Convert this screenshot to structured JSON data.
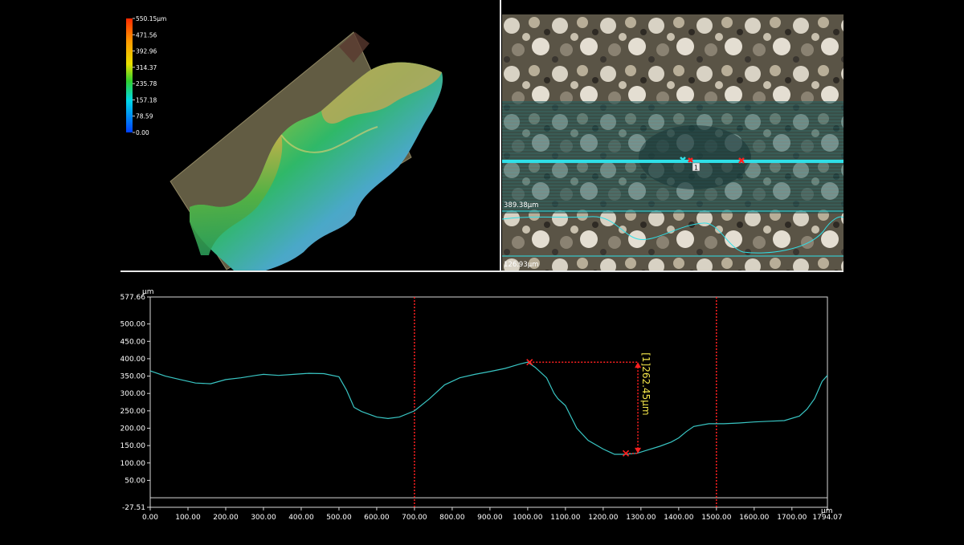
{
  "colorbar": {
    "ticks": [
      "550.15µm",
      "471.56",
      "392.96",
      "314.37",
      "235.78",
      "157.18",
      "78.59",
      "0.00"
    ]
  },
  "image_view": {
    "upper_line_label": "389.38µm",
    "lower_line_label": "126.93µm",
    "marker_label": "1",
    "colors": {
      "scan_line": "#2fe0e8",
      "marker": "#ff2020"
    }
  },
  "chart_data": {
    "type": "line",
    "xlabel": "µm",
    "ylabel": "µm",
    "xlim": [
      0.0,
      1794.07
    ],
    "ylim": [
      -27.51,
      577.66
    ],
    "x_ticks": [
      "0.00",
      "100.00",
      "200.00",
      "300.00",
      "400.00",
      "500.00",
      "600.00",
      "700.00",
      "800.00",
      "900.00",
      "1000.00",
      "1100.00",
      "1200.00",
      "1300.00",
      "1400.00",
      "1500.00",
      "1600.00",
      "1700.00",
      "1794.07"
    ],
    "y_ticks": [
      "577.66",
      "500.00",
      "450.00",
      "400.00",
      "350.00",
      "300.00",
      "250.00",
      "200.00",
      "150.00",
      "100.00",
      "50.00",
      "-27.51"
    ],
    "series": [
      {
        "x": [
          0,
          40,
          80,
          120,
          160,
          200,
          240,
          280,
          300,
          340,
          380,
          420,
          460,
          500,
          520,
          540,
          560,
          600,
          630,
          660,
          700,
          740,
          780,
          820,
          860,
          900,
          940,
          980,
          1000,
          1020,
          1050,
          1070,
          1080,
          1100,
          1130,
          1160,
          1200,
          1230,
          1260,
          1290,
          1320,
          1350,
          1380,
          1400,
          1420,
          1440,
          1480,
          1520,
          1560,
          1600,
          1640,
          1680,
          1720,
          1740,
          1760,
          1780,
          1794
        ],
        "y": [
          365,
          350,
          340,
          330,
          328,
          340,
          345,
          352,
          355,
          352,
          355,
          358,
          357,
          348,
          310,
          260,
          248,
          232,
          228,
          232,
          250,
          285,
          325,
          345,
          355,
          363,
          372,
          385,
          390,
          375,
          345,
          300,
          285,
          265,
          200,
          165,
          140,
          125,
          125,
          128,
          138,
          148,
          160,
          172,
          190,
          205,
          213,
          213,
          215,
          218,
          220,
          222,
          235,
          255,
          285,
          335,
          352
        ]
      }
    ],
    "cursor_lines_x": [
      700,
      1500
    ],
    "measure": {
      "label": "[1]262.45µm",
      "high": {
        "x": 1005,
        "y": 390
      },
      "low": {
        "x": 1260,
        "y": 127.55
      }
    },
    "colors": {
      "line": "#39c6c4",
      "cursor": "#ff2020",
      "measure_text": "#f4e64a"
    }
  }
}
